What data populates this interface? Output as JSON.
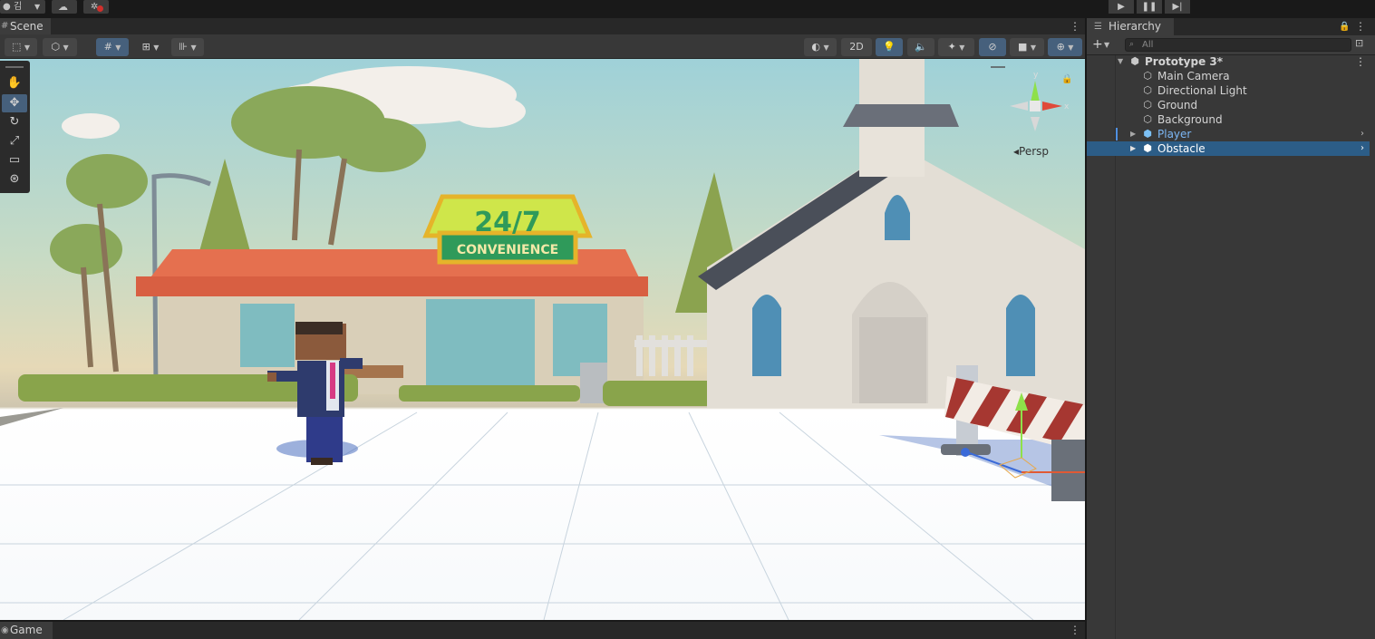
{
  "topbar": {
    "account_initial": "김"
  },
  "scene": {
    "tab_label": "Scene",
    "toolbar": {
      "mode_2d_label": "2D"
    },
    "gizmo": {
      "projection_label": "Persp",
      "axis_y": "y",
      "axis_x": "x"
    },
    "billboard": {
      "line1": "24/7",
      "line2": "CONVENIENCE"
    }
  },
  "game": {
    "tab_label": "Game"
  },
  "hierarchy": {
    "tab_label": "Hierarchy",
    "search_placeholder": "All",
    "root": {
      "label": "Prototype 3*"
    },
    "items": [
      {
        "label": "Main Camera"
      },
      {
        "label": "Directional Light"
      },
      {
        "label": "Ground"
      },
      {
        "label": "Background"
      },
      {
        "label": "Player"
      },
      {
        "label": "Obstacle"
      }
    ]
  },
  "colors": {
    "selection": "#2c5d87",
    "prefab_text": "#7cb7f5",
    "active_tool": "#46607c",
    "panel_bg": "#383838"
  }
}
